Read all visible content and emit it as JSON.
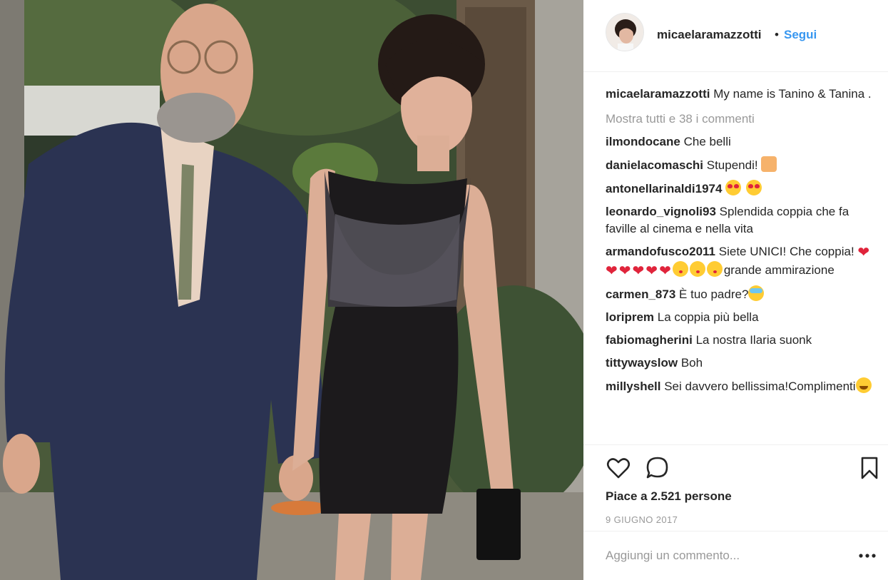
{
  "post": {
    "author": "micaelaramazzotti",
    "separator": "•",
    "follow_label": "Segui",
    "caption": {
      "user": "micaelaramazzotti",
      "text": "My name is Tanino & Tanina ."
    },
    "view_all_comments": "Mostra tutti e 38 i commenti",
    "comments": [
      {
        "user": "ilmondocane",
        "text": "Che belli"
      },
      {
        "user": "danielacomaschi",
        "text": "Stupendi!",
        "emojis": [
          "couple-heart"
        ]
      },
      {
        "user": "antonellarinaldi1974",
        "text": "",
        "emojis": [
          "heart-eyes",
          "heart-eyes"
        ]
      },
      {
        "user": "leonardo_vignoli93",
        "text": "Splendida coppia che fa faville al cinema e nella vita"
      },
      {
        "user": "armandofusco2011",
        "text": "Siete UNICI! Che coppia!",
        "emojis": [
          "red-heart",
          "red-heart",
          "red-heart",
          "heartbeat",
          "heartbeat",
          "heartbeat",
          "kiss-face",
          "kiss-face",
          "kiss-face"
        ],
        "suffix": "grande ammirazione"
      },
      {
        "user": "carmen_873",
        "text": "È tuo padre?",
        "emojis": [
          "dizzy-face"
        ]
      },
      {
        "user": "loriprem",
        "text": "La coppia più bella"
      },
      {
        "user": "fabiomagherini",
        "text": "La nostra Ilaria suonk"
      },
      {
        "user": "tittywayslow",
        "text": "Boh"
      },
      {
        "user": "millyshell",
        "text": "Sei davvero bellissima!Complimenti",
        "emojis": [
          "blush-face"
        ]
      }
    ],
    "likes": "Piace a 2.521 persone",
    "date": "9 GIUGNO 2017",
    "comment_placeholder": "Aggiungi un commento...",
    "more_label": "•••"
  },
  "icons": {
    "like": "heart-outline-icon",
    "comment": "speech-bubble-icon",
    "save": "bookmark-icon",
    "more": "ellipsis-icon"
  },
  "colors": {
    "link_blue": "#3897f0",
    "text": "#262626",
    "muted": "#999999",
    "divider": "#efefef"
  }
}
